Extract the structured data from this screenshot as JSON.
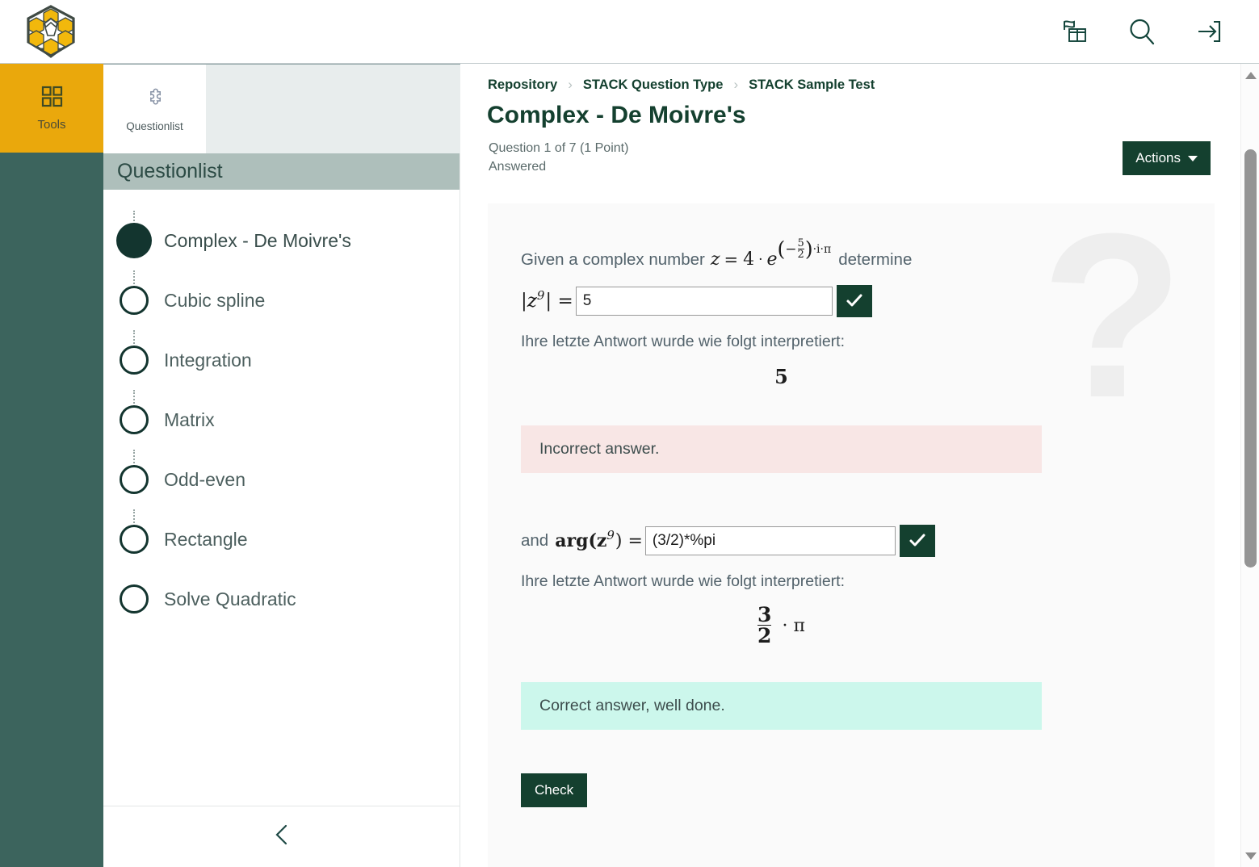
{
  "brand": {
    "logo_icon": "hexagon-cubes-logo"
  },
  "topbar": {
    "icons": [
      {
        "name": "repository-icon",
        "label": "Repository"
      },
      {
        "name": "search-icon",
        "label": "Search"
      },
      {
        "name": "login-icon",
        "label": "Login"
      }
    ]
  },
  "rail": {
    "tools": {
      "label": "Tools",
      "icon": "grid-icon"
    }
  },
  "tabstrip": {
    "questionlist": {
      "label": "Questionlist",
      "icon": "puzzle-piece-icon"
    }
  },
  "questionlist": {
    "header": "Questionlist",
    "collapse_icon": "chevron-left-icon",
    "items": [
      {
        "label": "Complex - De Moivre's",
        "active": true
      },
      {
        "label": "Cubic spline",
        "active": false
      },
      {
        "label": "Integration",
        "active": false
      },
      {
        "label": "Matrix",
        "active": false
      },
      {
        "label": "Odd-even",
        "active": false
      },
      {
        "label": "Rectangle",
        "active": false
      },
      {
        "label": "Solve Quadratic",
        "active": false
      }
    ]
  },
  "main": {
    "breadcrumb": [
      "Repository",
      "STACK Question Type",
      "STACK Sample Test"
    ],
    "title": "Complex - De Moivre's",
    "meta_line1": "Question 1 of 7 (1 Point)",
    "meta_line2": "Answered",
    "actions_label": "Actions",
    "watermark": "?"
  },
  "question": {
    "prompt_prefix": "Given a complex number",
    "prompt_suffix": "determine",
    "expression": {
      "z": "z",
      "equals": "=",
      "coefficient": "4",
      "dot": "·",
      "base": "e",
      "exp_num": "5",
      "exp_den": "2",
      "exp_sign": "−",
      "exp_tail": "·i·π"
    },
    "part1": {
      "label_abs": "|z",
      "label_exp": "9",
      "label_close": "| =",
      "input_value": "5",
      "validate_icon": "check-icon",
      "interpretation_text": "Ihre letzte Antwort wurde wie folgt interpretiert:",
      "interpretation_value": "5",
      "feedback": "Incorrect answer.",
      "feedback_type": "incorrect"
    },
    "part2": {
      "lead_and": "and",
      "label_arg": "arg(z",
      "label_exp": "9",
      "label_close": ") =",
      "input_value": "(3/2)*%pi",
      "validate_icon": "check-icon",
      "interpretation_text": "Ihre letzte Antwort wurde wie folgt interpretiert:",
      "interp_num": "3",
      "interp_den": "2",
      "interp_tail": "· π",
      "feedback": "Correct answer, well done.",
      "feedback_type": "correct"
    },
    "check_label": "Check"
  },
  "colors": {
    "dark_green": "#14402f",
    "teal_rail": "#3c645d",
    "amber": "#eaa80c",
    "sage_header": "#aebfbb",
    "incorrect_bg": "#f8e6e5",
    "correct_bg": "#ccf7ec",
    "card_bg": "#fafafa"
  }
}
